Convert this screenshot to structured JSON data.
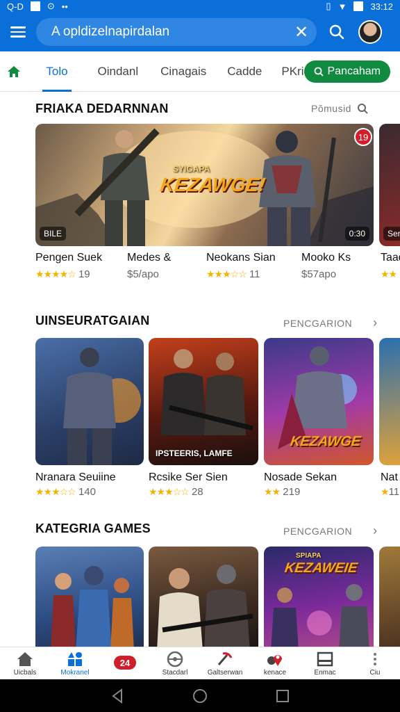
{
  "status": {
    "time": "33:12",
    "left_text": "Q-D"
  },
  "search": {
    "query": "A opldizelnapirdalan"
  },
  "tabs": [
    {
      "label": "Tolo",
      "active": true
    },
    {
      "label": "Oindanl",
      "active": false
    },
    {
      "label": "Cinagais",
      "active": false
    },
    {
      "label": "Cadde",
      "active": false
    },
    {
      "label": "PKri",
      "active": false
    }
  ],
  "tab_pill": {
    "label": "Pancaham"
  },
  "section1": {
    "title": "FRIAKA DEDARNNAN",
    "link": "Pŏmusid",
    "banner": {
      "logo": "KEZAWGE!",
      "logo_top": "SYIGAPA",
      "badge_left": "BILE",
      "badge_right": "0:30",
      "badge_red": "19",
      "peek_badge": "Ser"
    },
    "games": [
      {
        "name": "Pengen Suek",
        "meta": "19",
        "rating": 4.5
      },
      {
        "name": "Medes &",
        "meta": "$5/apo",
        "rating": null
      },
      {
        "name": "Neokans Sian",
        "meta": "11",
        "rating": 3
      },
      {
        "name": "Mooko Ks",
        "meta": "$57apo",
        "rating": null
      },
      {
        "name": "Taad",
        "meta": "",
        "rating": 3
      }
    ]
  },
  "section2": {
    "title": "UINSEURATGAIAN",
    "link": "PENCGARION",
    "cards": [
      {
        "name": "Nranara Seuiine",
        "meta": "140",
        "rating": 3,
        "overlay": ""
      },
      {
        "name": "Rcsike Ser Sien",
        "meta": "28",
        "rating": 2.5,
        "overlay": "IPSTEERIS, LAMFE"
      },
      {
        "name": "Nosade Sekan",
        "meta": "219",
        "rating": 2,
        "overlay": "KEZAWGE"
      },
      {
        "name": "Nat",
        "meta": "11",
        "rating": 1,
        "overlay": ""
      }
    ]
  },
  "section3": {
    "title": "KATEGRIA GAMES",
    "link": "PENCGARION",
    "card_logo": "KEZAWEIE",
    "card_logo_top": "SPIAPA"
  },
  "bottom_nav": [
    {
      "label": "Uicbals",
      "icon": "home-icon",
      "active": false
    },
    {
      "label": "Mokranel",
      "icon": "apps-icon",
      "active": true
    },
    {
      "label": "",
      "icon": "badge-24-icon",
      "active": false
    },
    {
      "label": "Stacdarl",
      "icon": "steering-icon",
      "active": false
    },
    {
      "label": "Galtserwan",
      "icon": "pickaxe-icon",
      "active": false
    },
    {
      "label": "kenace",
      "icon": "location-icon",
      "active": false
    },
    {
      "label": "Enmac",
      "icon": "inbox-icon",
      "active": false
    },
    {
      "label": "Ciu",
      "icon": "more-icon",
      "active": false
    }
  ],
  "colors": {
    "primary": "#0a6fd8",
    "pill": "#0f8a3f",
    "star": "#f4b400",
    "red": "#d01f2b"
  }
}
